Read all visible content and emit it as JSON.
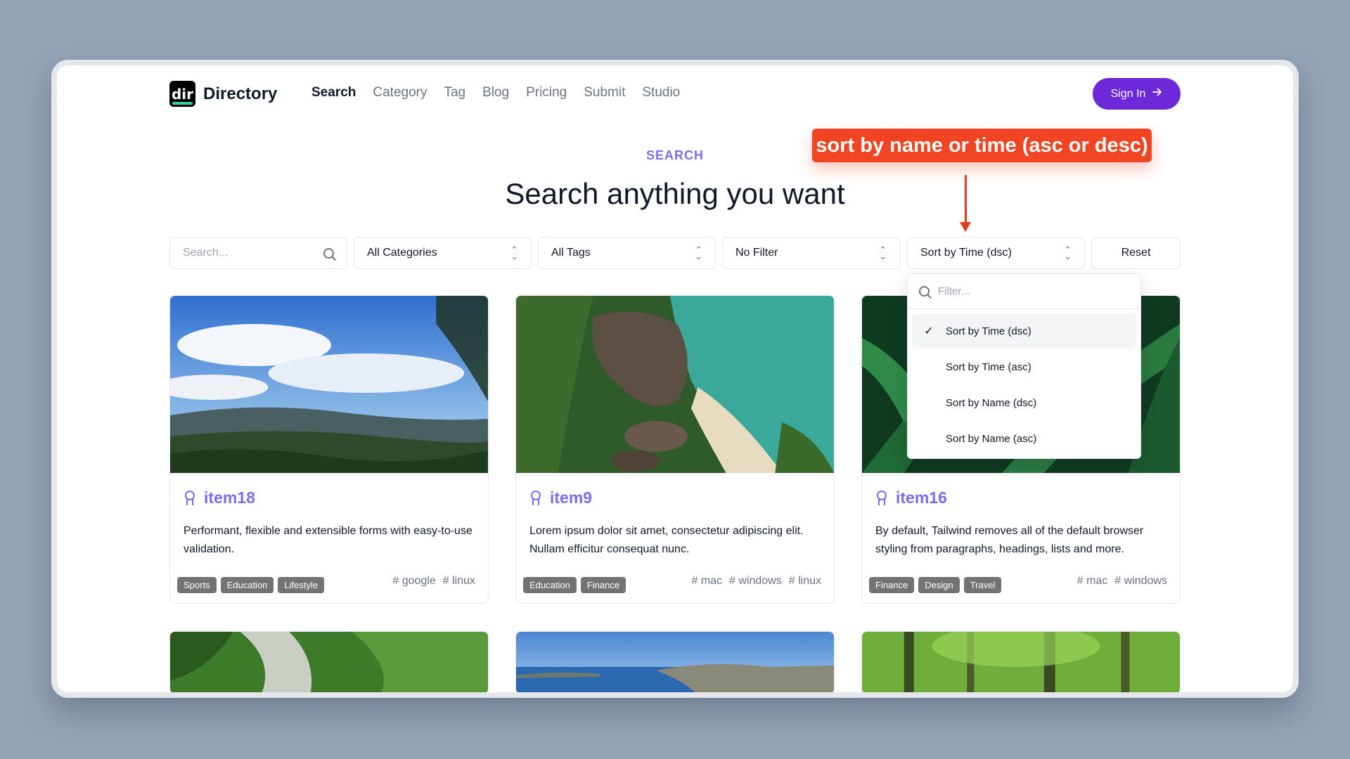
{
  "brand": {
    "logo_mark": "dir",
    "name": "Directory"
  },
  "nav": {
    "items": [
      {
        "label": "Search",
        "active": true
      },
      {
        "label": "Category",
        "active": false
      },
      {
        "label": "Tag",
        "active": false
      },
      {
        "label": "Blog",
        "active": false
      },
      {
        "label": "Pricing",
        "active": false
      },
      {
        "label": "Submit",
        "active": false
      },
      {
        "label": "Studio",
        "active": false
      }
    ],
    "signin_label": "Sign In"
  },
  "hero": {
    "eyebrow": "SEARCH",
    "title": "Search anything you want"
  },
  "annotation": {
    "text": "sort by name or time (asc or desc)"
  },
  "filters": {
    "search_placeholder": "Search...",
    "category": "All Categories",
    "tags": "All Tags",
    "filter": "No Filter",
    "sort": "Sort by Time (dsc)",
    "reset_label": "Reset"
  },
  "sort_dropdown": {
    "filter_placeholder": "Filter...",
    "options": [
      {
        "label": "Sort by Time (dsc)",
        "selected": true
      },
      {
        "label": "Sort by Time (asc)",
        "selected": false
      },
      {
        "label": "Sort by Name (dsc)",
        "selected": false
      },
      {
        "label": "Sort by Name (asc)",
        "selected": false
      }
    ]
  },
  "cards": [
    {
      "title": "item18",
      "categories": [
        "Sports",
        "Education",
        "Lifestyle"
      ],
      "description": "Performant, flexible and extensible forms with easy-to-use validation.",
      "tags": [
        "google",
        "linux"
      ]
    },
    {
      "title": "item9",
      "categories": [
        "Education",
        "Finance"
      ],
      "description": "Lorem ipsum dolor sit amet, consectetur adipiscing elit. Nullam efficitur consequat nunc.",
      "tags": [
        "mac",
        "windows",
        "linux"
      ]
    },
    {
      "title": "item16",
      "categories": [
        "Finance",
        "Design",
        "Travel"
      ],
      "description": "By default, Tailwind removes all of the default browser styling from paragraphs, headings, lists and more.",
      "tags": [
        "mac",
        "windows"
      ]
    }
  ],
  "colors": {
    "accent": "#7c6cf0",
    "button": "#6d28d9",
    "callout": "#f04423",
    "background": "#94a3b8"
  }
}
